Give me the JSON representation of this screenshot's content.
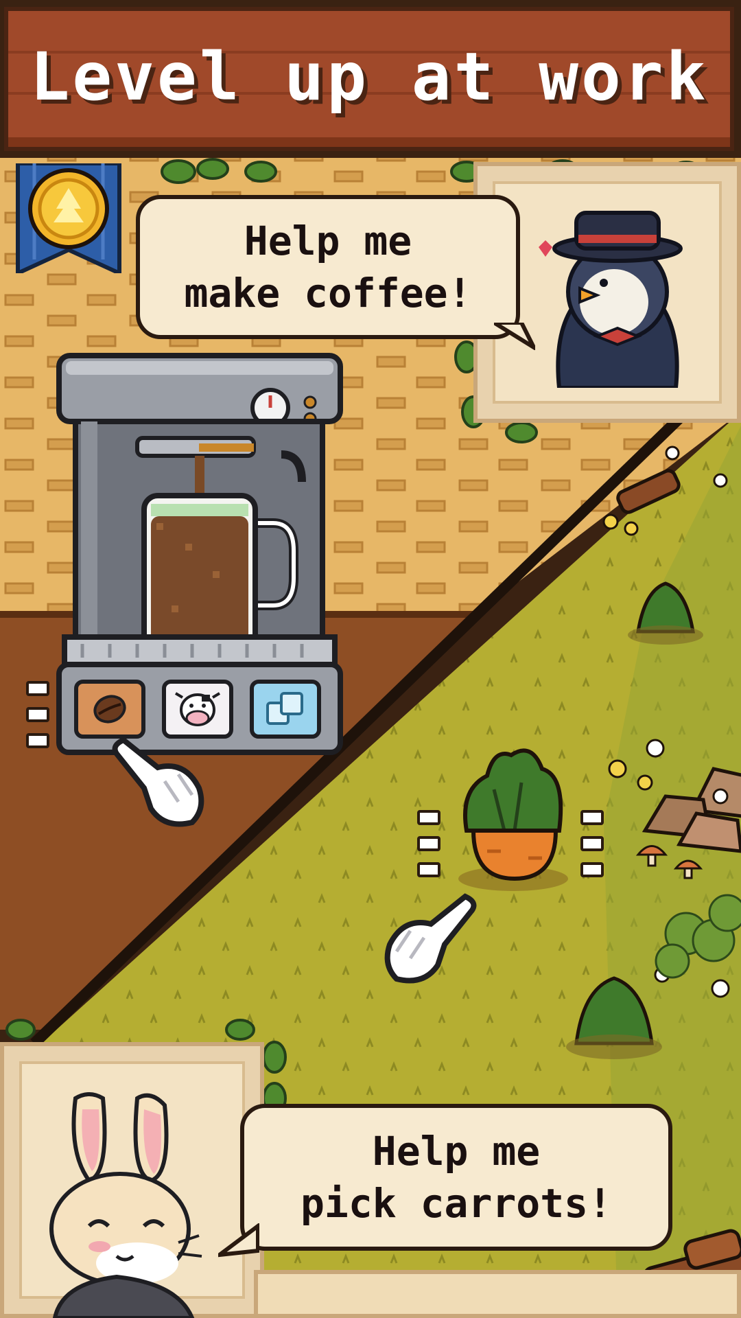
{
  "banner": {
    "title": "Level up at work"
  },
  "coffee_scene": {
    "speech": {
      "line1": "Help me",
      "line2": "make coffee!"
    },
    "ingredient_buttons": [
      "coffee-bean-icon",
      "cow-milk-icon",
      "ice-cube-icon"
    ]
  },
  "farm_scene": {
    "speech": {
      "line1": "Help me",
      "line2": "pick carrots!"
    }
  },
  "colors": {
    "banner": "#a0492a",
    "brick_wall": "#e7b767",
    "wood_floor": "#8e4e24",
    "grass": "#b5ae32",
    "bubble": "#f7ead0"
  }
}
